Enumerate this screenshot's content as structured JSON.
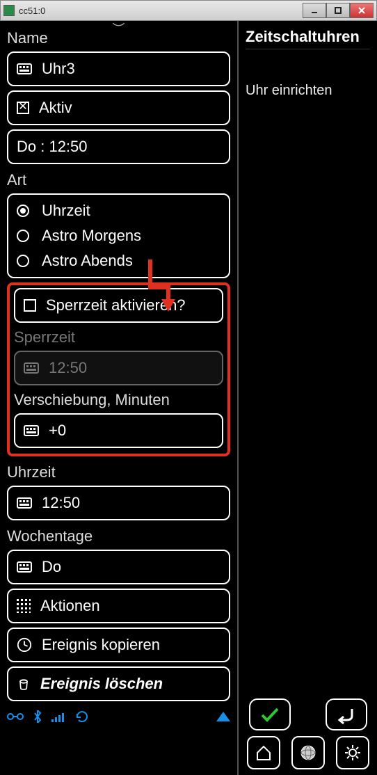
{
  "window": {
    "title": "cc51:0"
  },
  "left": {
    "name_label": "Name",
    "name_value": "Uhr3",
    "active_label": "Aktiv",
    "active_checked": true,
    "summary": "Do : 12:50",
    "art_label": "Art",
    "art_options": [
      {
        "label": "Uhrzeit",
        "selected": true
      },
      {
        "label": "Astro Morgens",
        "selected": false
      },
      {
        "label": "Astro Abends",
        "selected": false
      }
    ],
    "sperr_activate_label": "Sperrzeit aktivieren?",
    "sperr_activate_checked": false,
    "sperrzeit_label": "Sperrzeit",
    "sperrzeit_value": "12:50",
    "verschiebung_label": "Verschiebung, Minuten",
    "verschiebung_value": "+0",
    "uhrzeit_label": "Uhrzeit",
    "uhrzeit_value": "12:50",
    "wochentage_label": "Wochentage",
    "wochentage_value": "Do",
    "aktionen_label": "Aktionen",
    "copy_label": "Ereignis kopieren",
    "delete_label": "Ereignis löschen"
  },
  "right": {
    "title": "Zeitschaltuhren",
    "subtitle": "Uhr einrichten"
  }
}
